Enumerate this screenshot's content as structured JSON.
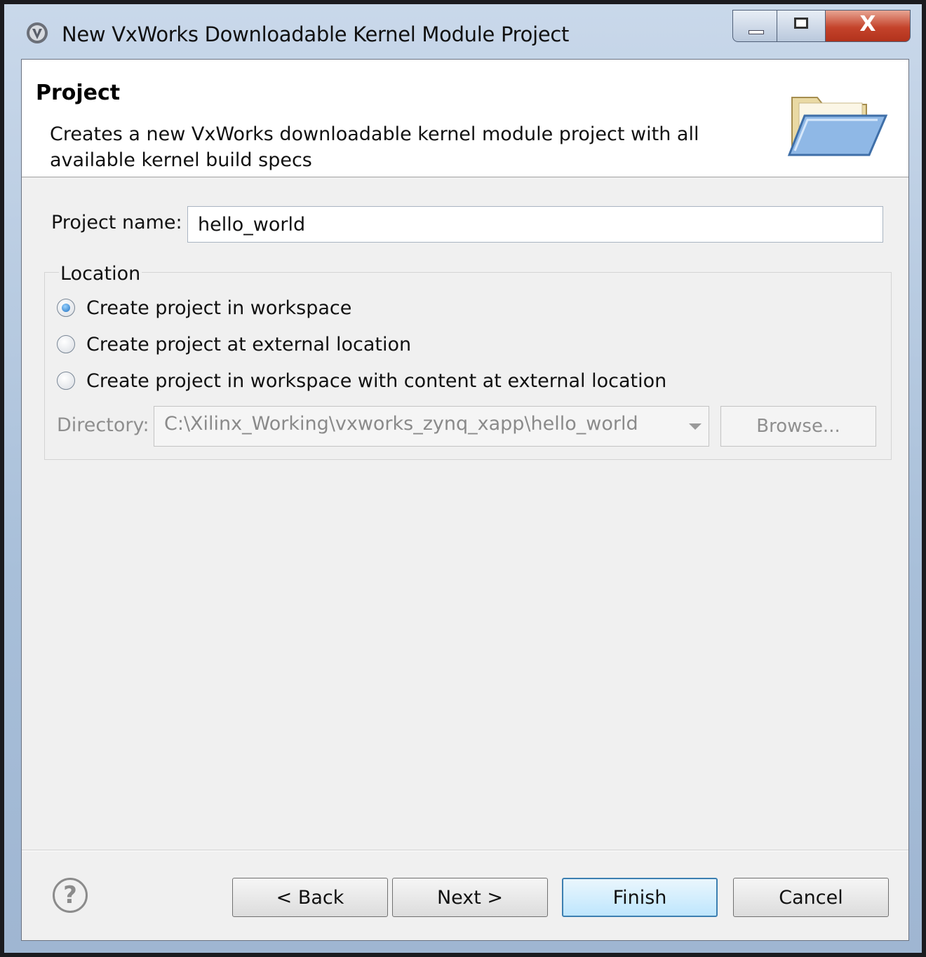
{
  "window": {
    "title": "New VxWorks Downloadable Kernel Module Project",
    "close_glyph": "X"
  },
  "banner": {
    "title": "Project",
    "description": "Creates a new VxWorks downloadable kernel module project with all available kernel build specs"
  },
  "form": {
    "project_name_label": "Project name:",
    "project_name_value": "hello_world",
    "location": {
      "group_label": "Location",
      "options": [
        {
          "label": "Create project in workspace",
          "selected": true
        },
        {
          "label": "Create project at external location",
          "selected": false
        },
        {
          "label": "Create project in workspace with content at external location",
          "selected": false
        }
      ],
      "directory_label": "Directory:",
      "directory_value": "C:\\Xilinx_Working\\vxworks_zynq_xapp\\hello_world",
      "browse_label": "Browse..."
    }
  },
  "footer": {
    "help_glyph": "?",
    "back_label": "< Back",
    "next_label": "Next >",
    "finish_label": "Finish",
    "cancel_label": "Cancel"
  },
  "colors": {
    "accent": "#3c7fb1",
    "close_red": "#c4432b",
    "dialog_bg": "#f0f0f0"
  }
}
